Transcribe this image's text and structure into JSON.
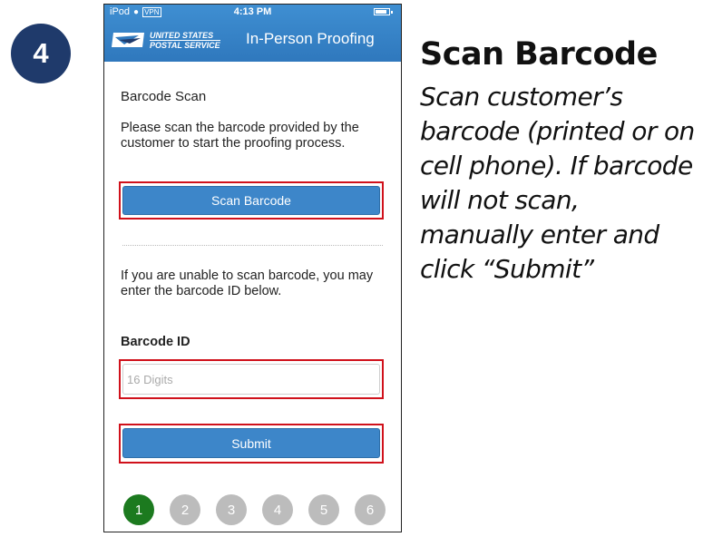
{
  "step_number": "4",
  "status_bar": {
    "device": "iPod",
    "vpn": "VPN",
    "time": "4:13 PM"
  },
  "header": {
    "logo_line1": "UNITED STATES",
    "logo_line2": "POSTAL SERVICE",
    "title": "In-Person Proofing",
    "brand_color": "#3a86cc"
  },
  "main": {
    "page_title": "Barcode Scan",
    "instructions": "Please scan the barcode provided by the customer to start the proofing process.",
    "scan_button": "Scan Barcode",
    "manual_instructions": "If you are unable to scan barcode, you may enter the barcode ID below.",
    "barcode_label": "Barcode ID",
    "barcode_value": "",
    "barcode_placeholder": "16 Digits",
    "submit_button": "Submit"
  },
  "progress": {
    "steps": [
      "1",
      "2",
      "3",
      "4",
      "5",
      "6"
    ],
    "current": 1
  },
  "side_panel": {
    "title": "Scan Barcode",
    "description": "Scan customer’s barcode (printed or on cell phone). If barcode will not scan, manually enter and click “Submit”"
  },
  "colors": {
    "highlight": "#d0111b",
    "badge": "#1f3a6b",
    "active_step": "#1c7a1f",
    "inactive_step": "#bcbcbc"
  }
}
